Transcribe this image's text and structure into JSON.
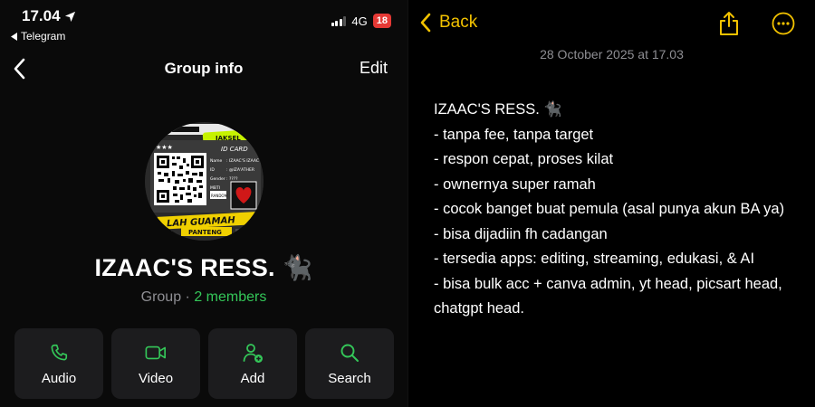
{
  "left": {
    "status": {
      "time": "17.04",
      "back_app": "Telegram",
      "network": "4G",
      "battery": "18"
    },
    "nav": {
      "title": "Group info",
      "edit_label": "Edit"
    },
    "group": {
      "name": "IZAAC'S RESS.",
      "name_emoji": "🐈‍⬛",
      "type": "Group",
      "separator": "·",
      "members": "2 members"
    },
    "avatar": {
      "texts": [
        "CHARACTER",
        "JAKSEL",
        "ID CARD",
        "LAH GUAMAH",
        "PANTENG",
        "Name",
        ": IZAAC'S IZAAC",
        "ID",
        ": @IZA'ATHER",
        "Gender",
        ": ????",
        "MBTI",
        ": RANDOMIST"
      ]
    },
    "actions": [
      {
        "label": "Audio",
        "icon": "phone-icon"
      },
      {
        "label": "Video",
        "icon": "video-icon"
      },
      {
        "label": "Add",
        "icon": "add-member-icon"
      },
      {
        "label": "Search",
        "icon": "search-icon"
      }
    ],
    "accent": "#34c759"
  },
  "right": {
    "back_label": "Back",
    "date": "28 October 2025 at 17.03",
    "accent": "#f2c200",
    "lines": [
      "IZAAC'S RESS. 🐈‍⬛",
      "- tanpa fee, tanpa target",
      "- respon cepat, proses kilat",
      "- ownernya super ramah",
      "- cocok banget buat pemula (asal punya akun BA ya)",
      "- bisa dijadiin fh cadangan",
      "- tersedia apps: editing, streaming, edukasi, & AI",
      "- bisa bulk acc + canva admin, yt head, picsart head, chatgpt head."
    ]
  }
}
